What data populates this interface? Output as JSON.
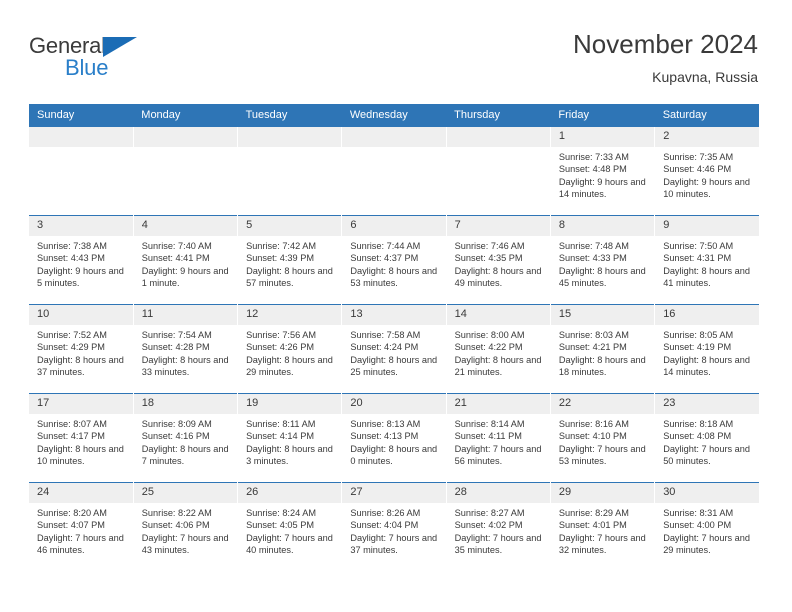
{
  "brand": {
    "name_top": "General",
    "name_bottom": "Blue",
    "triangle_color": "#1b6cb5",
    "blue_text_color": "#2a7fc9"
  },
  "header": {
    "title": "November 2024",
    "subtitle": "Kupavna, Russia"
  },
  "theme": {
    "header_blue": "#2e75b6",
    "daynum_gray": "#efefef",
    "text_color": "#3a3a3a"
  },
  "weekday_headers": [
    "Sunday",
    "Monday",
    "Tuesday",
    "Wednesday",
    "Thursday",
    "Friday",
    "Saturday"
  ],
  "weeks": [
    [
      {
        "day": "",
        "empty": true
      },
      {
        "day": "",
        "empty": true
      },
      {
        "day": "",
        "empty": true
      },
      {
        "day": "",
        "empty": true
      },
      {
        "day": "",
        "empty": true
      },
      {
        "day": "1",
        "sunrise": "Sunrise: 7:33 AM",
        "sunset": "Sunset: 4:48 PM",
        "daylight": "Daylight: 9 hours and 14 minutes."
      },
      {
        "day": "2",
        "sunrise": "Sunrise: 7:35 AM",
        "sunset": "Sunset: 4:46 PM",
        "daylight": "Daylight: 9 hours and 10 minutes."
      }
    ],
    [
      {
        "day": "3",
        "sunrise": "Sunrise: 7:38 AM",
        "sunset": "Sunset: 4:43 PM",
        "daylight": "Daylight: 9 hours and 5 minutes."
      },
      {
        "day": "4",
        "sunrise": "Sunrise: 7:40 AM",
        "sunset": "Sunset: 4:41 PM",
        "daylight": "Daylight: 9 hours and 1 minute."
      },
      {
        "day": "5",
        "sunrise": "Sunrise: 7:42 AM",
        "sunset": "Sunset: 4:39 PM",
        "daylight": "Daylight: 8 hours and 57 minutes."
      },
      {
        "day": "6",
        "sunrise": "Sunrise: 7:44 AM",
        "sunset": "Sunset: 4:37 PM",
        "daylight": "Daylight: 8 hours and 53 minutes."
      },
      {
        "day": "7",
        "sunrise": "Sunrise: 7:46 AM",
        "sunset": "Sunset: 4:35 PM",
        "daylight": "Daylight: 8 hours and 49 minutes."
      },
      {
        "day": "8",
        "sunrise": "Sunrise: 7:48 AM",
        "sunset": "Sunset: 4:33 PM",
        "daylight": "Daylight: 8 hours and 45 minutes."
      },
      {
        "day": "9",
        "sunrise": "Sunrise: 7:50 AM",
        "sunset": "Sunset: 4:31 PM",
        "daylight": "Daylight: 8 hours and 41 minutes."
      }
    ],
    [
      {
        "day": "10",
        "sunrise": "Sunrise: 7:52 AM",
        "sunset": "Sunset: 4:29 PM",
        "daylight": "Daylight: 8 hours and 37 minutes."
      },
      {
        "day": "11",
        "sunrise": "Sunrise: 7:54 AM",
        "sunset": "Sunset: 4:28 PM",
        "daylight": "Daylight: 8 hours and 33 minutes."
      },
      {
        "day": "12",
        "sunrise": "Sunrise: 7:56 AM",
        "sunset": "Sunset: 4:26 PM",
        "daylight": "Daylight: 8 hours and 29 minutes."
      },
      {
        "day": "13",
        "sunrise": "Sunrise: 7:58 AM",
        "sunset": "Sunset: 4:24 PM",
        "daylight": "Daylight: 8 hours and 25 minutes."
      },
      {
        "day": "14",
        "sunrise": "Sunrise: 8:00 AM",
        "sunset": "Sunset: 4:22 PM",
        "daylight": "Daylight: 8 hours and 21 minutes."
      },
      {
        "day": "15",
        "sunrise": "Sunrise: 8:03 AM",
        "sunset": "Sunset: 4:21 PM",
        "daylight": "Daylight: 8 hours and 18 minutes."
      },
      {
        "day": "16",
        "sunrise": "Sunrise: 8:05 AM",
        "sunset": "Sunset: 4:19 PM",
        "daylight": "Daylight: 8 hours and 14 minutes."
      }
    ],
    [
      {
        "day": "17",
        "sunrise": "Sunrise: 8:07 AM",
        "sunset": "Sunset: 4:17 PM",
        "daylight": "Daylight: 8 hours and 10 minutes."
      },
      {
        "day": "18",
        "sunrise": "Sunrise: 8:09 AM",
        "sunset": "Sunset: 4:16 PM",
        "daylight": "Daylight: 8 hours and 7 minutes."
      },
      {
        "day": "19",
        "sunrise": "Sunrise: 8:11 AM",
        "sunset": "Sunset: 4:14 PM",
        "daylight": "Daylight: 8 hours and 3 minutes."
      },
      {
        "day": "20",
        "sunrise": "Sunrise: 8:13 AM",
        "sunset": "Sunset: 4:13 PM",
        "daylight": "Daylight: 8 hours and 0 minutes."
      },
      {
        "day": "21",
        "sunrise": "Sunrise: 8:14 AM",
        "sunset": "Sunset: 4:11 PM",
        "daylight": "Daylight: 7 hours and 56 minutes."
      },
      {
        "day": "22",
        "sunrise": "Sunrise: 8:16 AM",
        "sunset": "Sunset: 4:10 PM",
        "daylight": "Daylight: 7 hours and 53 minutes."
      },
      {
        "day": "23",
        "sunrise": "Sunrise: 8:18 AM",
        "sunset": "Sunset: 4:08 PM",
        "daylight": "Daylight: 7 hours and 50 minutes."
      }
    ],
    [
      {
        "day": "24",
        "sunrise": "Sunrise: 8:20 AM",
        "sunset": "Sunset: 4:07 PM",
        "daylight": "Daylight: 7 hours and 46 minutes."
      },
      {
        "day": "25",
        "sunrise": "Sunrise: 8:22 AM",
        "sunset": "Sunset: 4:06 PM",
        "daylight": "Daylight: 7 hours and 43 minutes."
      },
      {
        "day": "26",
        "sunrise": "Sunrise: 8:24 AM",
        "sunset": "Sunset: 4:05 PM",
        "daylight": "Daylight: 7 hours and 40 minutes."
      },
      {
        "day": "27",
        "sunrise": "Sunrise: 8:26 AM",
        "sunset": "Sunset: 4:04 PM",
        "daylight": "Daylight: 7 hours and 37 minutes."
      },
      {
        "day": "28",
        "sunrise": "Sunrise: 8:27 AM",
        "sunset": "Sunset: 4:02 PM",
        "daylight": "Daylight: 7 hours and 35 minutes."
      },
      {
        "day": "29",
        "sunrise": "Sunrise: 8:29 AM",
        "sunset": "Sunset: 4:01 PM",
        "daylight": "Daylight: 7 hours and 32 minutes."
      },
      {
        "day": "30",
        "sunrise": "Sunrise: 8:31 AM",
        "sunset": "Sunset: 4:00 PM",
        "daylight": "Daylight: 7 hours and 29 minutes."
      }
    ]
  ]
}
